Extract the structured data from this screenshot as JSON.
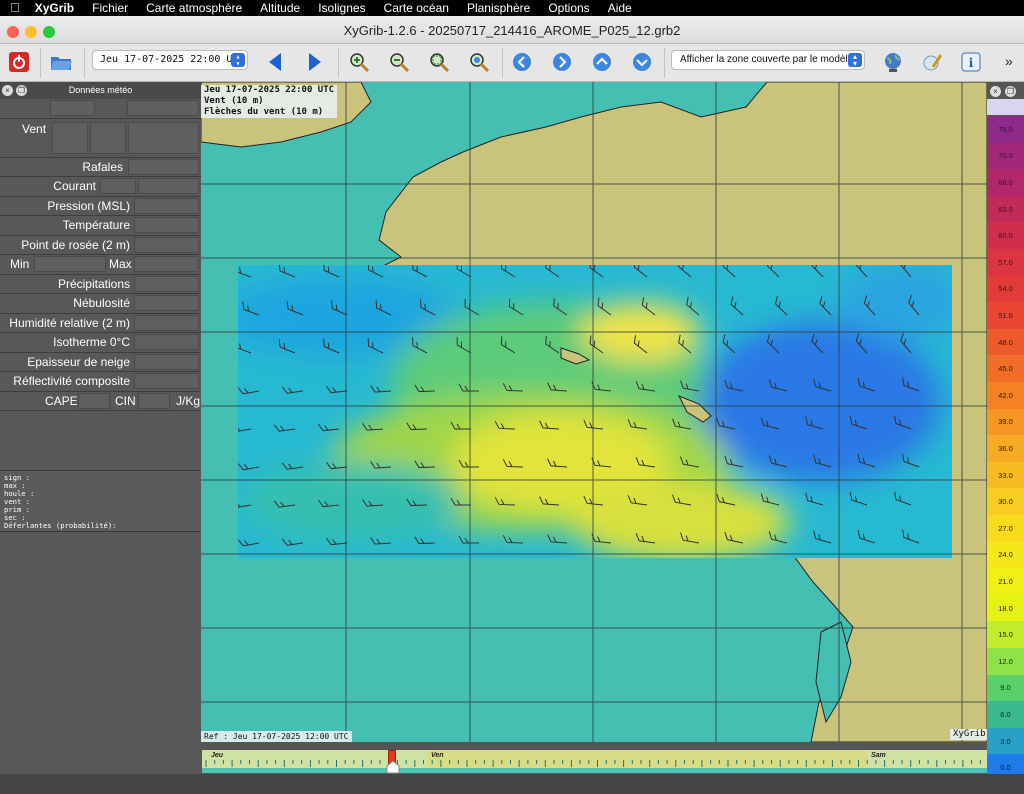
{
  "menubar": {
    "app": "XyGrib",
    "items": [
      "Fichier",
      "Carte atmosphère",
      "Altitude",
      "Isolignes",
      "Carte océan",
      "Planisphère",
      "Options",
      "Aide"
    ]
  },
  "window": {
    "title": "XyGrib-1.2.6 - 20250717_214416_AROME_P025_12.grb2"
  },
  "toolbar": {
    "date_value": "Jeu 17-07-2025 22:00 UTC",
    "zone_value": "Afficher la zone couverte par le modèle",
    "more": "»"
  },
  "left_panel": {
    "title": "Données météo",
    "rows": {
      "vent": "Vent",
      "rafales": "Rafales",
      "courant": "Courant",
      "pression": "Pression (MSL)",
      "temperature": "Température",
      "rosee": "Point de rosée (2 m)",
      "min": "Min",
      "max": "Max",
      "precip": "Précipitations",
      "nebulosite": "Nébulosité",
      "humidite": "Humidité relative (2 m)",
      "isotherme": "Isotherme 0°C",
      "neige": "Epaisseur de neige",
      "reflectivite": "Réflectivité composite",
      "cape": "CAPE",
      "cin": "CIN",
      "unit": "J/Kg"
    },
    "details": [
      "sign :",
      "max :",
      "houle :",
      "vent :",
      "prim :",
      "sec :",
      "Déferlantes (probabilité):"
    ]
  },
  "map": {
    "overlay": [
      "Jeu 17-07-2025 22:00 UTC",
      "Vent (10 m)",
      "Flèches du vent (10 m)"
    ],
    "ref": "Ref : Jeu 17-07-2025 12:00 UTC",
    "brand": "XyGrib"
  },
  "legend": [
    {
      "label": "75.0",
      "color": "#8e2a8a"
    },
    {
      "label": "70.0",
      "color": "#a1287a"
    },
    {
      "label": "66.0",
      "color": "#b3286a"
    },
    {
      "label": "63.0",
      "color": "#c22a5a"
    },
    {
      "label": "60.0",
      "color": "#d02e4c"
    },
    {
      "label": "57.0",
      "color": "#dc3440"
    },
    {
      "label": "54.0",
      "color": "#e33c38"
    },
    {
      "label": "51.0",
      "color": "#ea4632"
    },
    {
      "label": "48.0",
      "color": "#ef5a2c"
    },
    {
      "label": "45.0",
      "color": "#f26e28"
    },
    {
      "label": "42.0",
      "color": "#f48224"
    },
    {
      "label": "39.0",
      "color": "#f69624"
    },
    {
      "label": "36.0",
      "color": "#f7aa24"
    },
    {
      "label": "33.0",
      "color": "#f8bc22"
    },
    {
      "label": "30.0",
      "color": "#f8cc20"
    },
    {
      "label": "27.0",
      "color": "#f8dc1c"
    },
    {
      "label": "24.0",
      "color": "#f5e81a"
    },
    {
      "label": "21.0",
      "color": "#f0f016"
    },
    {
      "label": "18.0",
      "color": "#e6f214"
    },
    {
      "label": "15.0",
      "color": "#c2ec2a"
    },
    {
      "label": "12.0",
      "color": "#8ee24a"
    },
    {
      "label": "9.0",
      "color": "#5ad06a"
    },
    {
      "label": "6.0",
      "color": "#3ab88e"
    },
    {
      "label": "3.0",
      "color": "#2aa0c8"
    },
    {
      "label": "0.0",
      "color": "#1f7be8"
    }
  ],
  "timeline": {
    "days": [
      "Jeu",
      "Ven",
      "Sam"
    ]
  }
}
